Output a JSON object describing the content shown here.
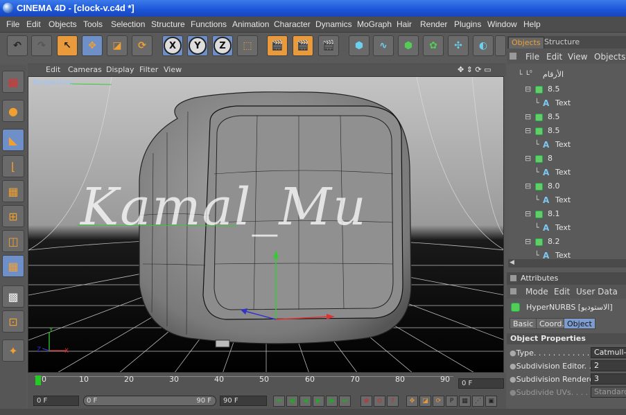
{
  "window": {
    "title": "CINEMA 4D - [clock-v.c4d *]"
  },
  "menu": [
    "File",
    "Edit",
    "Objects",
    "Tools",
    "Selection",
    "Structure",
    "Functions",
    "Animation",
    "Character",
    "Dynamics",
    "MoGraph",
    "Hair",
    "Render",
    "Plugins",
    "Window",
    "Help"
  ],
  "toolbar": {
    "axis_x": "X",
    "axis_y": "Y",
    "axis_z": "Z"
  },
  "viewport": {
    "menu": [
      "Edit",
      "Cameras",
      "Display",
      "Filter",
      "View"
    ],
    "label": "Perspective",
    "watermark": "Kamal_Mu"
  },
  "timeline": {
    "ticks": [
      "0",
      "10",
      "20",
      "30",
      "40",
      "50",
      "60",
      "70",
      "80",
      "90"
    ],
    "current_frame": "0 F",
    "start_field": "0 F",
    "range_start": "0 F",
    "range_end": "90 F",
    "end_field": "90 F"
  },
  "objects_panel": {
    "tabs": [
      "Objects",
      "Structure"
    ],
    "menu": [
      "File",
      "Edit",
      "View",
      "Objects"
    ],
    "root": "الأرقام",
    "items": [
      {
        "name": "8.5",
        "child": "Text"
      },
      {
        "name": "8.5",
        "child": ""
      },
      {
        "name": "8.5",
        "child": "Text"
      },
      {
        "name": "8",
        "child": "Text"
      },
      {
        "name": "8.0",
        "child": "Text"
      },
      {
        "name": "8.1",
        "child": "Text"
      },
      {
        "name": "8.2",
        "child": "Text"
      }
    ]
  },
  "attributes": {
    "title": "Attributes",
    "menu": [
      "Mode",
      "Edit",
      "User Data"
    ],
    "object_name": "HyperNURBS [الاستوديو]",
    "tabs": [
      "Basic",
      "Coord.",
      "Object"
    ],
    "section": "Object Properties",
    "props": [
      {
        "label": "Type. . . . . . . . . . . . . . .",
        "value": "Catmull-C"
      },
      {
        "label": "Subdivision Editor. . .",
        "value": "2"
      },
      {
        "label": "Subdivision Renderer",
        "value": "3"
      },
      {
        "label": "Subdivide UVs. . . . . .",
        "value": "Standard"
      }
    ]
  },
  "colors": {
    "accent": "#e89a3c",
    "selected": "#7e9ccf",
    "title_bar": "#1c54d8"
  }
}
